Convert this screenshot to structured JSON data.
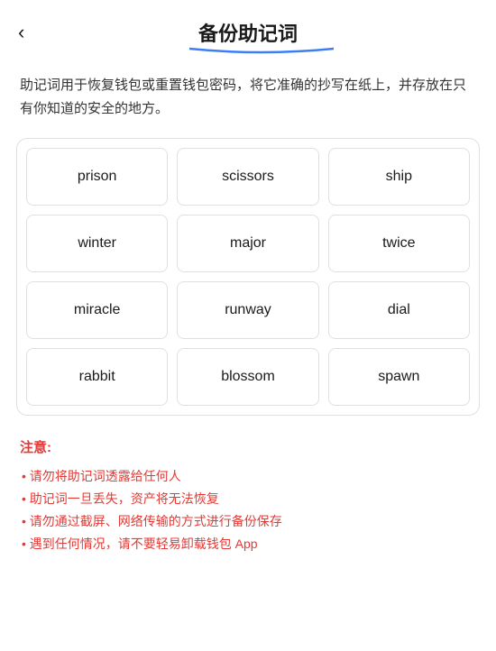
{
  "header": {
    "back_icon": "‹",
    "title": "备份助记词"
  },
  "description": "助记词用于恢复钱包或重置钱包密码，将它准确的抄写在纸上，并存放在只有你知道的安全的地方。",
  "mnemonic_grid": {
    "words": [
      "prison",
      "scissors",
      "ship",
      "winter",
      "major",
      "twice",
      "miracle",
      "runway",
      "dial",
      "rabbit",
      "blossom",
      "spawn"
    ]
  },
  "notice": {
    "title": "注意:",
    "items": [
      "请勿将助记词透露给任何人",
      "助记词一旦丢失，资产将无法恢复",
      "请勿通过截屏、网络传输的方式进行备份保存",
      "遇到任何情况，请不要轻易卸载钱包 App"
    ]
  }
}
